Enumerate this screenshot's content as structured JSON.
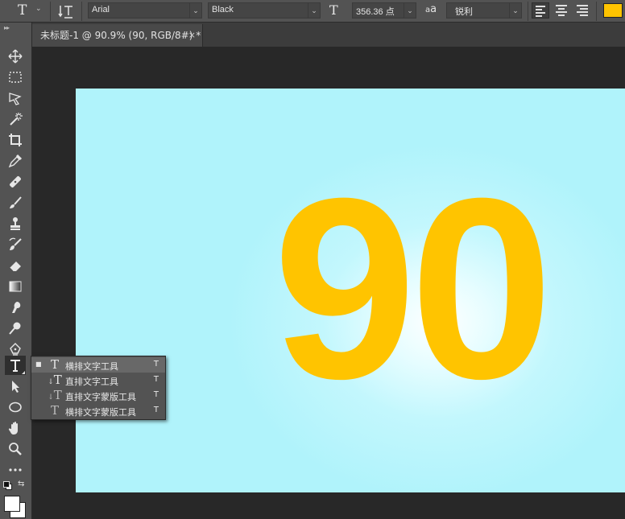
{
  "options_bar": {
    "tool_icon": "T",
    "font_family": "Arial",
    "font_style": "Black",
    "font_size": "356.36 点",
    "aa_label": "a",
    "anti_alias": "锐利",
    "text_color": "#ffc400"
  },
  "document_tab": {
    "title": "未标题-1 @ 90.9% (90, RGB/8#) *",
    "close": "×"
  },
  "canvas": {
    "text_content": "90",
    "text_color": "#ffc400",
    "background_color": "#b0f3fb"
  },
  "toolbar": {
    "collapse": "▸▸",
    "tools": [
      "move-icon",
      "marquee-icon",
      "lasso-icon",
      "magic-wand-icon",
      "crop-icon",
      "eyedropper-icon",
      "healing-brush-icon",
      "brush-icon",
      "clone-stamp-icon",
      "history-brush-icon",
      "eraser-icon",
      "gradient-icon",
      "smudge-icon",
      "dodge-icon",
      "pen-icon",
      "type-icon",
      "path-selection-icon",
      "ellipse-icon",
      "hand-icon",
      "zoom-icon",
      "more-icon"
    ]
  },
  "flyout": {
    "items": [
      {
        "icon": "T",
        "label": "横排文字工具",
        "shortcut": "T",
        "selected": true
      },
      {
        "icon": "T",
        "label": "直排文字工具",
        "shortcut": "T",
        "selected": false
      },
      {
        "icon": "T",
        "label": "直排文字蒙版工具",
        "shortcut": "T",
        "selected": false
      },
      {
        "icon": "T",
        "label": "横排文字蒙版工具",
        "shortcut": "T",
        "selected": false
      }
    ]
  }
}
